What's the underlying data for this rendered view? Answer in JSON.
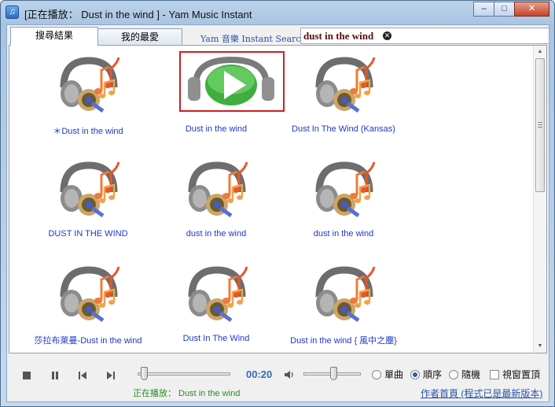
{
  "window": {
    "title": "[正在播放： Dust in the wind ] - Yam Music Instant",
    "minimize_glyph": "–",
    "maximize_glyph": "□",
    "close_glyph": "✕"
  },
  "tabs": [
    {
      "label": "搜尋結果",
      "active": true
    },
    {
      "label": "我的最愛",
      "active": false
    }
  ],
  "search": {
    "label": "Yam 音樂 Instant Search：",
    "value": "dust in the wind"
  },
  "results": [
    {
      "title": "＊Dust in the wind",
      "icon": "music-headphones-icon",
      "selected": false
    },
    {
      "title": "Dust in the wind",
      "icon": "play-headphones-icon",
      "selected": true
    },
    {
      "title": "Dust In The Wind (Kansas)",
      "icon": "music-headphones-icon",
      "selected": false
    },
    {
      "title": "DUST IN THE WIND",
      "icon": "music-headphones-icon",
      "selected": false
    },
    {
      "title": "dust in the wind",
      "icon": "music-headphones-icon",
      "selected": false
    },
    {
      "title": "dust in the wind",
      "icon": "music-headphones-icon",
      "selected": false
    },
    {
      "title": "莎拉布萊曼-Dust in the wind",
      "icon": "music-headphones-icon",
      "selected": false
    },
    {
      "title": "Dust In The Wind",
      "icon": "music-headphones-icon",
      "selected": false
    },
    {
      "title": "Dust in the wind { 風中之塵}",
      "icon": "music-headphones-icon",
      "selected": false
    }
  ],
  "player": {
    "time": "00:20",
    "seek_fraction": 0.06,
    "volume_fraction": 0.5,
    "now_playing": "正在播放：  Dust in the wind",
    "modes": [
      {
        "label": "單曲",
        "selected": false
      },
      {
        "label": "順序",
        "selected": true
      },
      {
        "label": "隨機",
        "selected": false
      }
    ],
    "always_on_top": {
      "label": "視窗置頂",
      "checked": false
    },
    "home_link": "作者首頁 (程式已是最新版本)"
  },
  "colors": {
    "result_text": "#1d38c9",
    "selected_border": "#d11d1d",
    "time_text": "#2f6dbd",
    "now_playing_text": "#2b8a2b"
  }
}
